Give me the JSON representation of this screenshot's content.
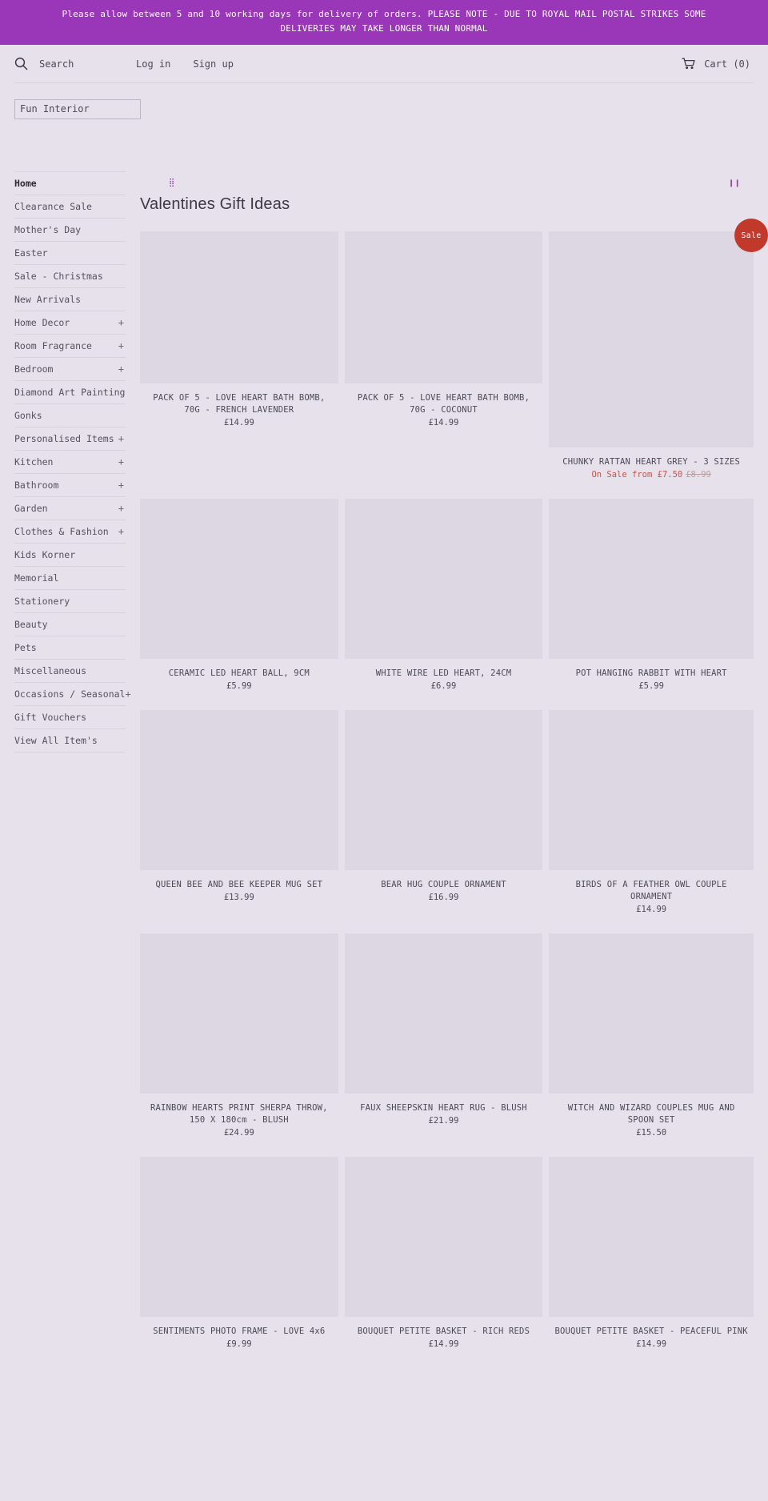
{
  "announcement": {
    "text": "Please allow between 5 and 10 working days for delivery of orders. PLEASE NOTE - DUE TO ROYAL MAIL POSTAL STRIKES SOME DELIVERIES MAY TAKE LONGER THAN NORMAL",
    "bg_color": "#9a36b8"
  },
  "header": {
    "search_label": "Search",
    "search_icon": "search-icon",
    "login_label": "Log in",
    "signup_label": "Sign up",
    "cart_label": "Cart (0)",
    "cart_icon": "cart-icon"
  },
  "logo": {
    "text": "Fun Interior"
  },
  "sidebar": {
    "items": [
      {
        "label": "Home",
        "expandable": false,
        "active": true
      },
      {
        "label": "Clearance Sale",
        "expandable": false,
        "active": false
      },
      {
        "label": "Mother's Day",
        "expandable": false,
        "active": false
      },
      {
        "label": "Easter",
        "expandable": false,
        "active": false
      },
      {
        "label": "Sale - Christmas",
        "expandable": false,
        "active": false
      },
      {
        "label": "New Arrivals",
        "expandable": false,
        "active": false
      },
      {
        "label": "Home Decor",
        "expandable": true,
        "active": false
      },
      {
        "label": "Room Fragrance",
        "expandable": true,
        "active": false
      },
      {
        "label": "Bedroom",
        "expandable": true,
        "active": false
      },
      {
        "label": "Diamond Art Painting",
        "expandable": false,
        "active": false
      },
      {
        "label": "Gonks",
        "expandable": false,
        "active": false
      },
      {
        "label": "Personalised Items",
        "expandable": true,
        "active": false
      },
      {
        "label": "Kitchen",
        "expandable": true,
        "active": false
      },
      {
        "label": "Bathroom",
        "expandable": true,
        "active": false
      },
      {
        "label": "Garden",
        "expandable": true,
        "active": false
      },
      {
        "label": "Clothes & Fashion",
        "expandable": true,
        "active": false
      },
      {
        "label": "Kids Korner",
        "expandable": false,
        "active": false
      },
      {
        "label": "Memorial",
        "expandable": false,
        "active": false
      },
      {
        "label": "Stationery",
        "expandable": false,
        "active": false
      },
      {
        "label": "Beauty",
        "expandable": false,
        "active": false
      },
      {
        "label": "Pets",
        "expandable": false,
        "active": false
      },
      {
        "label": "Miscellaneous",
        "expandable": false,
        "active": false
      },
      {
        "label": "Occasions / Seasonal",
        "expandable": true,
        "active": false
      },
      {
        "label": "Gift Vouchers",
        "expandable": false,
        "active": false
      },
      {
        "label": "View All Item's",
        "expandable": false,
        "active": false
      }
    ],
    "expand_symbol": "+"
  },
  "slider": {
    "dots_icon": "slider-dots-icon",
    "dots_glyph": "⣿",
    "pause_icon": "pause-icon",
    "pause_glyph": "❙❙"
  },
  "main": {
    "title": "Valentines Gift Ideas",
    "sale_badge_label": "Sale",
    "products": [
      {
        "title": "PACK OF 5 - LOVE HEART BATH BOMB, 70G - FRENCH LAVENDER",
        "price": "£14.99",
        "on_sale": false,
        "thumb": "h190"
      },
      {
        "title": "PACK OF 5 - LOVE HEART BATH BOMB, 70G - COCONUT",
        "price": "£14.99",
        "on_sale": false,
        "thumb": "h190"
      },
      {
        "title": "CHUNKY RATTAN HEART GREY - 3 SIZES",
        "price": "On Sale from £7.50",
        "compare_price": "£8.99",
        "on_sale": true,
        "thumb": "h270"
      },
      {
        "title": "CERAMIC LED HEART BALL, 9CM",
        "price": "£5.99",
        "on_sale": false,
        "thumb": "h200"
      },
      {
        "title": "WHITE WIRE LED HEART, 24CM",
        "price": "£6.99",
        "on_sale": false,
        "thumb": "h200"
      },
      {
        "title": "POT HANGING RABBIT WITH HEART",
        "price": "£5.99",
        "on_sale": false,
        "thumb": "h200"
      },
      {
        "title": "QUEEN BEE AND BEE KEEPER MUG SET",
        "price": "£13.99",
        "on_sale": false,
        "thumb": "h200"
      },
      {
        "title": "BEAR HUG COUPLE ORNAMENT",
        "price": "£16.99",
        "on_sale": false,
        "thumb": "h200"
      },
      {
        "title": "BIRDS OF A FEATHER OWL COUPLE ORNAMENT",
        "price": "£14.99",
        "on_sale": false,
        "thumb": "h200"
      },
      {
        "title": "RAINBOW HEARTS PRINT SHERPA THROW, 150 X 180cm - BLUSH",
        "price": "£24.99",
        "on_sale": false,
        "thumb": "h200"
      },
      {
        "title": "FAUX SHEEPSKIN HEART RUG - BLUSH",
        "price": "£21.99",
        "on_sale": false,
        "thumb": "h200"
      },
      {
        "title": "WITCH AND WIZARD COUPLES MUG AND SPOON SET",
        "price": "£15.50",
        "on_sale": false,
        "thumb": "h200"
      },
      {
        "title": "SENTIMENTS PHOTO FRAME - LOVE 4x6",
        "price": "£9.99",
        "on_sale": false,
        "thumb": "h200"
      },
      {
        "title": "BOUQUET PETITE BASKET - RICH REDS",
        "price": "£14.99",
        "on_sale": false,
        "thumb": "h200"
      },
      {
        "title": "BOUQUET PETITE BASKET - PEACEFUL PINK",
        "price": "£14.99",
        "on_sale": false,
        "thumb": "h200"
      }
    ]
  }
}
